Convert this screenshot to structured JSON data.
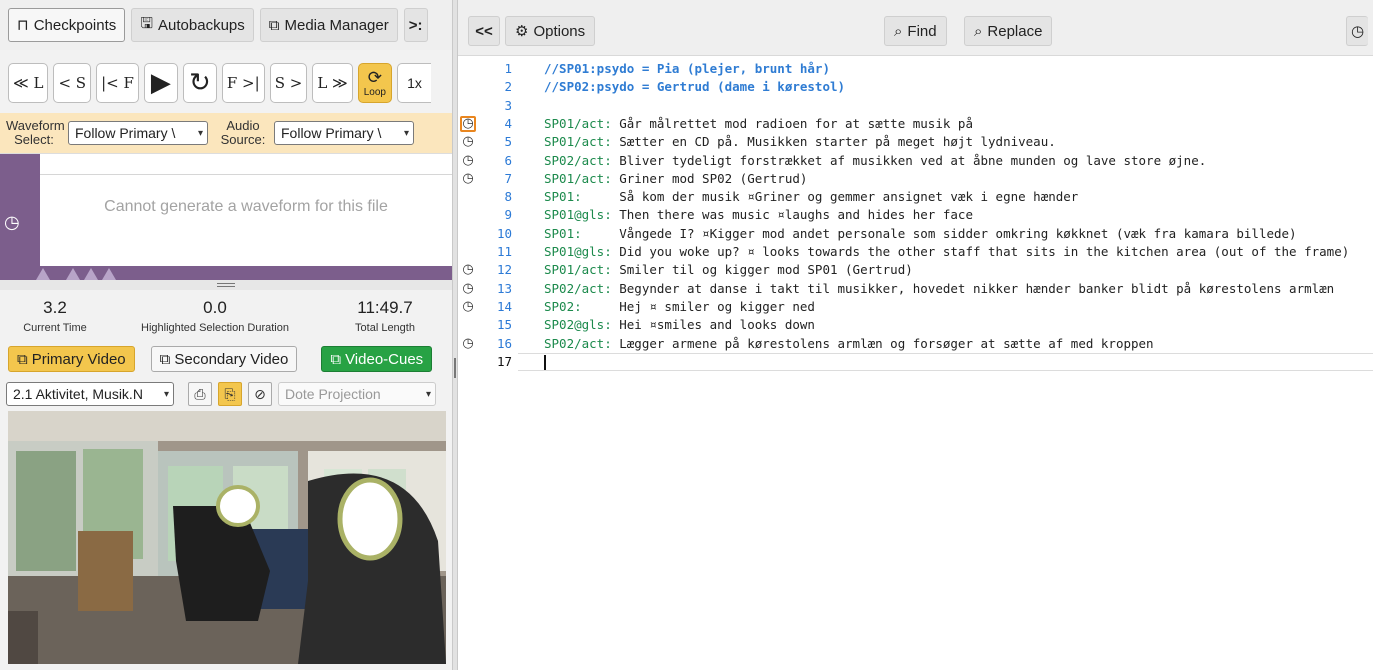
{
  "left_tabs": [
    {
      "icon": "bookmark-icon",
      "glyph": "⊓",
      "label": "Checkpoints"
    },
    {
      "icon": "save-icon",
      "glyph": "🖫",
      "label": "Autobackups"
    },
    {
      "icon": "media-icon",
      "glyph": "⧉",
      "label": "Media Manager"
    },
    {
      "icon": "more-icon",
      "glyph": "",
      "label": ">:"
    }
  ],
  "transport": {
    "back_l": "≪ L",
    "back_s": "< S",
    "frame_back": "|< F",
    "play": "▶",
    "replay_glyph": "↻",
    "frame_fwd": "F >|",
    "fwd_s": "S >",
    "fwd_l": "L ≫",
    "loop_glyph": "⟳",
    "loop_label": "Loop",
    "rate": "1x"
  },
  "waveform": {
    "select_label": "Waveform Select:",
    "select_value": "Follow Primary \\",
    "audio_label": "Audio Source:",
    "audio_value": "Follow Primary \\",
    "message": "Cannot generate a waveform for this file",
    "clock_glyph": "◷"
  },
  "times": {
    "current_value": "3.2",
    "current_label": "Current Time",
    "selection_value": "0.0",
    "selection_label": "Highlighted Selection Duration",
    "total_value": "11:49.7",
    "total_label": "Total Length"
  },
  "video_tabs": {
    "primary": "Primary Video",
    "secondary": "Secondary Video",
    "cues": "Video-Cues",
    "tab_glyph": "⧉"
  },
  "video_select": {
    "file": "2.1 Aktivitet, Musik.N",
    "projection": "Dote Projection"
  },
  "editor_toolbar": {
    "collapse": "<<",
    "options": "Options",
    "options_glyph": "⚙",
    "find": "Find",
    "replace": "Replace",
    "find_glyph": "⌕",
    "extra_glyph": "◷"
  },
  "gutter_icon_glyph": "◷",
  "lines": [
    {
      "n": "1",
      "icon": false,
      "speaker": "",
      "text": "",
      "comment": "//SP01:psydo = Pia (plejer, brunt hår)"
    },
    {
      "n": "2",
      "icon": false,
      "speaker": "",
      "text": "",
      "comment": "//SP02:psydo = Gertrud (dame i kørestol)"
    },
    {
      "n": "3",
      "icon": false,
      "speaker": "",
      "text": "",
      "comment": ""
    },
    {
      "n": "4",
      "icon": true,
      "hl": true,
      "speaker": "SP01/act:",
      "text": " Går målrettet mod radioen for at sætte musik på",
      "comment": ""
    },
    {
      "n": "5",
      "icon": true,
      "speaker": "SP01/act:",
      "text": " Sætter en CD på. Musikken starter på meget højt lydniveau.",
      "comment": ""
    },
    {
      "n": "6",
      "icon": true,
      "speaker": "SP02/act:",
      "text": " Bliver tydeligt forstrækket af musikken ved at åbne munden og lave store øjne.",
      "comment": ""
    },
    {
      "n": "7",
      "icon": true,
      "speaker": "SP01/act:",
      "text": " Griner mod SP02 (Gertrud)",
      "comment": ""
    },
    {
      "n": "8",
      "icon": false,
      "speaker": "SP01:",
      "text": "     Så kom der musik ¤Griner og gemmer ansignet væk i egne hænder",
      "comment": ""
    },
    {
      "n": "9",
      "icon": false,
      "speaker": "SP01@gls:",
      "text": " Then there was music ¤laughs and hides her face",
      "comment": ""
    },
    {
      "n": "10",
      "icon": false,
      "speaker": "SP01:",
      "text": "     Vångede I? ¤Kigger mod andet personale som sidder omkring køkknet (væk fra kamara billede)",
      "comment": ""
    },
    {
      "n": "11",
      "icon": false,
      "speaker": "SP01@gls:",
      "text": " Did you woke up? ¤ looks towards the other staff that sits in the kitchen area (out of the frame)",
      "comment": ""
    },
    {
      "n": "12",
      "icon": true,
      "speaker": "SP01/act:",
      "text": " Smiler til og kigger mod SP01 (Gertrud)",
      "comment": ""
    },
    {
      "n": "13",
      "icon": true,
      "speaker": "SP02/act:",
      "text": " Begynder at danse i takt til musikker, hovedet nikker hænder banker blidt på kørestolens armlæn",
      "comment": ""
    },
    {
      "n": "14",
      "icon": true,
      "speaker": "SP02:",
      "text": "     Hej ¤ smiler og kigger ned",
      "comment": ""
    },
    {
      "n": "15",
      "icon": false,
      "speaker": "SP02@gls:",
      "text": " Hei ¤smiles and looks down",
      "comment": ""
    },
    {
      "n": "16",
      "icon": true,
      "speaker": "SP02/act:",
      "text": " Lægger armene på kørestolens armlæn og forsøger at sætte af med kroppen",
      "comment": ""
    },
    {
      "n": "17",
      "icon": false,
      "current": true,
      "speaker": "",
      "text": "",
      "comment": ""
    }
  ],
  "colors": {
    "accent_yellow": "#f3c64d",
    "cue_green": "#27a244",
    "waveform_purple": "#7c5e8c",
    "speaker_green": "#1c8a4c",
    "comment_blue": "#2f7cd3",
    "highlight_orange": "#e9861f"
  }
}
